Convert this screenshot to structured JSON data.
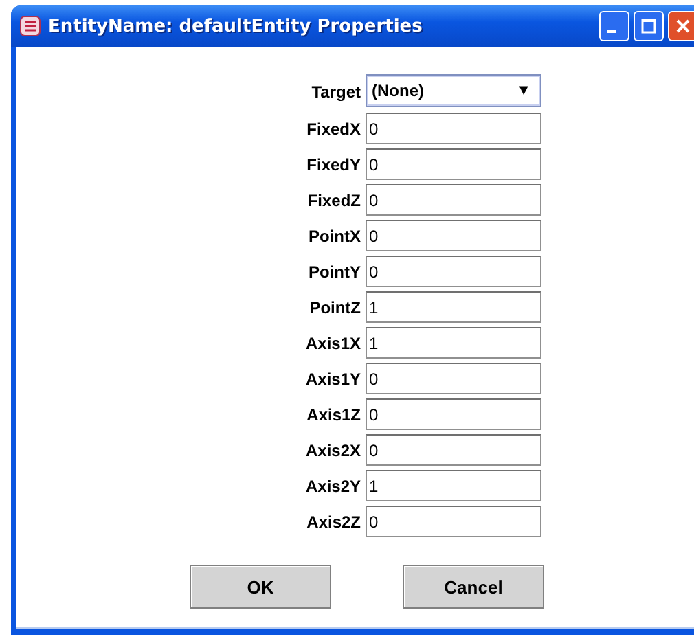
{
  "window": {
    "title": "EntityName: defaultEntity Properties"
  },
  "target": {
    "label": "Target",
    "value": "(None)",
    "arrow": "▼"
  },
  "fields": [
    {
      "label": "FixedX",
      "value": "0"
    },
    {
      "label": "FixedY",
      "value": "0"
    },
    {
      "label": "FixedZ",
      "value": "0"
    },
    {
      "label": "PointX",
      "value": "0"
    },
    {
      "label": "PointY",
      "value": "0"
    },
    {
      "label": "PointZ",
      "value": "1"
    },
    {
      "label": "Axis1X",
      "value": "1"
    },
    {
      "label": "Axis1Y",
      "value": "0"
    },
    {
      "label": "Axis1Z",
      "value": "0"
    },
    {
      "label": "Axis2X",
      "value": "0"
    },
    {
      "label": "Axis2Y",
      "value": "1"
    },
    {
      "label": "Axis2Z",
      "value": "0"
    }
  ],
  "buttons": [
    "OK",
    "Cancel"
  ]
}
